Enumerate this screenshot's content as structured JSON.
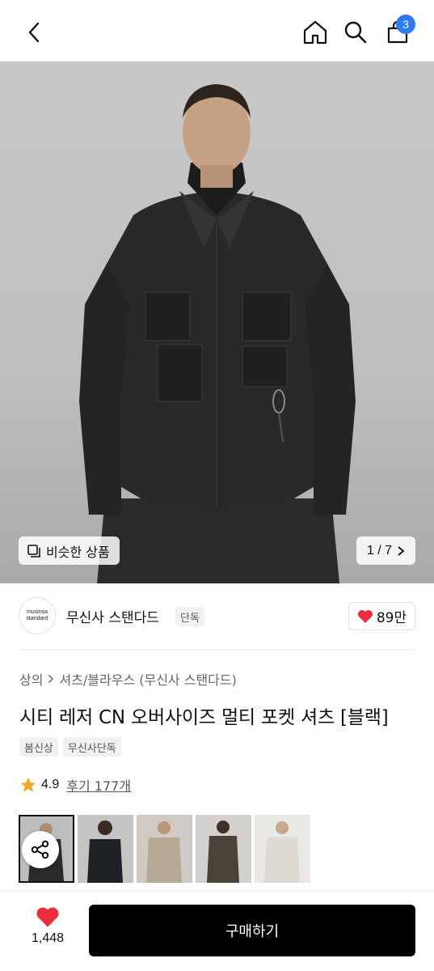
{
  "header": {
    "cart_count": "3",
    "icons": [
      "back-icon",
      "home-icon",
      "search-icon",
      "shopping-bag-icon"
    ]
  },
  "hero": {
    "similar_label": "비슷한 상품",
    "page_indicator": "1 / 7"
  },
  "brand": {
    "logo_line1": "musinsa",
    "logo_line2": "standard",
    "name": "무신사 스탠다드",
    "tag": "단독",
    "likes": "89만"
  },
  "breadcrumb": {
    "level1": "상의",
    "level2": "셔츠/블라우스 (무신사 스탠다드)"
  },
  "product": {
    "title": "시티 레저 CN 오버사이즈 멀티 포켓 셔츠 [블랙]",
    "chips": [
      "봄신상",
      "무신사단독"
    ],
    "rating": "4.9",
    "reviews": "후기 177개"
  },
  "bottom": {
    "wish_count": "1,448",
    "buy_label": "구매하기"
  },
  "colors": {
    "accent_red": "#ee2d3c",
    "badge_blue": "#2b7cf6",
    "star": "#f5a623"
  }
}
